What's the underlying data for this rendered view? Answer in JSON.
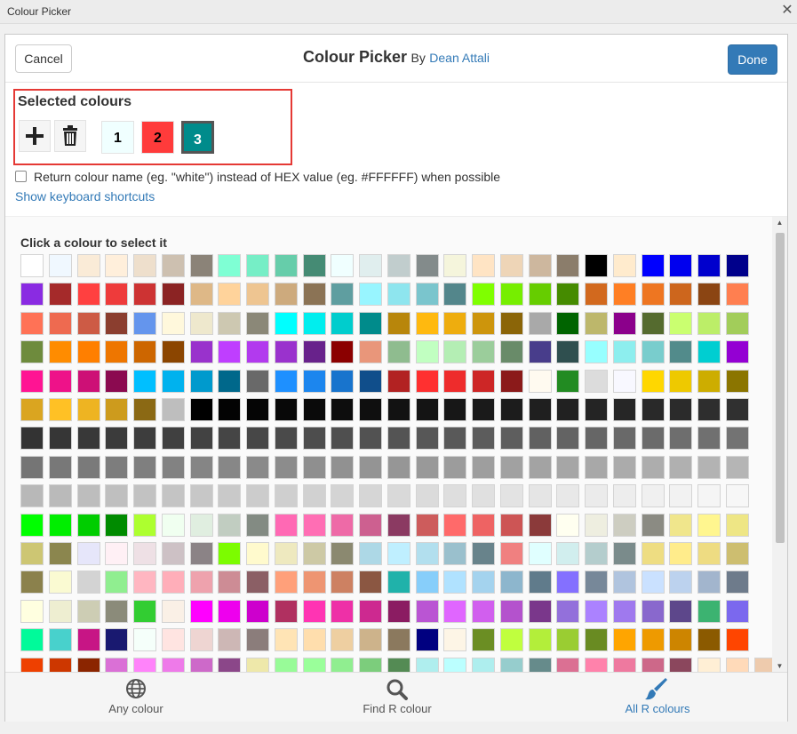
{
  "window": {
    "title": "Colour Picker"
  },
  "header": {
    "cancel_label": "Cancel",
    "title": "Colour Picker",
    "by": "By",
    "author": "Dean Attali",
    "done_label": "Done"
  },
  "selected": {
    "label": "Selected colours",
    "swatches": [
      {
        "label": "1",
        "color": "#F0FFFF",
        "text_color": "#000000"
      },
      {
        "label": "2",
        "color": "#FF3B3B",
        "text_color": "#000000"
      },
      {
        "label": "3",
        "color": "#008B8B",
        "text_color": "#FFFFFF"
      }
    ]
  },
  "options": {
    "return_name_label": "Return colour name (eg. \"white\") instead of HEX value (eg. #FFFFFF) when possible",
    "return_name_checked": false,
    "shortcuts_link": "Show keyboard shortcuts"
  },
  "palette": {
    "label": "Click a colour to select it",
    "rows": [
      [
        "#FFFFFF",
        "#F0F8FF",
        "#FAEBD7",
        "#FFEFDB",
        "#EEDFCC",
        "#CDC0B0",
        "#8B8378",
        "#7FFFD4",
        "#76EEC6",
        "#66CDAA",
        "#458B74",
        "#F0FFFF",
        "#E0EEEE",
        "#C1CDCD",
        "#838B8B",
        "#F5F5DC",
        "#FFE4C4",
        "#EED5B7",
        "#CDB79E",
        "#8B7D6B",
        "#000000",
        "#FFEBCD",
        "#0000FF",
        "#0000EE",
        "#0000CD",
        "#00008B"
      ],
      [
        "#8A2BE2",
        "#A52A2A",
        "#FF4040",
        "#EE3B3B",
        "#CD3333",
        "#8B2323",
        "#DEB887",
        "#FFD39B",
        "#EEC591",
        "#CDAA7D",
        "#8B7355",
        "#5F9EA0",
        "#98F5FF",
        "#8EE5EE",
        "#7AC5CD",
        "#53868B",
        "#7FFF00",
        "#76EE00",
        "#66CD00",
        "#458B00",
        "#D2691E",
        "#FF7F24",
        "#EE7621",
        "#CD661D",
        "#8B4513",
        "#FF7F50"
      ],
      [
        "#FF7256",
        "#EE6A50",
        "#CD5B45",
        "#8B3E2F",
        "#6495ED",
        "#FFF8DC",
        "#EEE8CD",
        "#CDC8B1",
        "#8B8878",
        "#00FFFF",
        "#00EEEE",
        "#00CDCD",
        "#008B8B",
        "#B8860B",
        "#FFB90F",
        "#EEAD0E",
        "#CD950C",
        "#8B6508",
        "#A9A9A9",
        "#006400",
        "#BDB76B",
        "#8B008B",
        "#556B2F",
        "#CAFF70",
        "#BCEE68",
        "#A2CD5A"
      ],
      [
        "#6E8B3D",
        "#FF8C00",
        "#FF7F00",
        "#EE7600",
        "#CD6600",
        "#8B4500",
        "#9932CC",
        "#BF3EFF",
        "#B23AEE",
        "#9A32CD",
        "#68228B",
        "#8B0000",
        "#E9967A",
        "#8FBC8F",
        "#C1FFC1",
        "#B4EEB4",
        "#9BCD9B",
        "#698B69",
        "#483D8B",
        "#2F4F4F",
        "#97FFFF",
        "#8DEEEE",
        "#79CDCD",
        "#528B8B",
        "#00CED1",
        "#9400D3"
      ],
      [
        "#FF1493",
        "#EE1289",
        "#CD1076",
        "#8B0A50",
        "#00BFFF",
        "#00B2EE",
        "#009ACD",
        "#00688B",
        "#696969",
        "#1E90FF",
        "#1C86EE",
        "#1874CD",
        "#104E8B",
        "#B22222",
        "#FF3030",
        "#EE2C2C",
        "#CD2626",
        "#8B1A1A",
        "#FFFAF0",
        "#228B22",
        "#DCDCDC",
        "#F8F8FF",
        "#FFD700",
        "#EEC900",
        "#CDAD00",
        "#8B7500"
      ],
      [
        "#DAA520",
        "#FFC125",
        "#EEB422",
        "#CD9B1D",
        "#8B6914",
        "#BEBEBE",
        "#000000",
        "#030303",
        "#050505",
        "#080808",
        "#0A0A0A",
        "#0D0D0D",
        "#0F0F0F",
        "#121212",
        "#141414",
        "#171717",
        "#1A1A1A",
        "#1C1C1C",
        "#1F1F1F",
        "#212121",
        "#242424",
        "#262626",
        "#292929",
        "#2B2B2B",
        "#2E2E2E",
        "#303030"
      ],
      [
        "#333333",
        "#363636",
        "#383838",
        "#3B3B3B",
        "#3D3D3D",
        "#404040",
        "#424242",
        "#454545",
        "#474747",
        "#4A4A4A",
        "#4D4D4D",
        "#4F4F4F",
        "#525252",
        "#545454",
        "#575757",
        "#595959",
        "#5C5C5C",
        "#5E5E5E",
        "#616161",
        "#636363",
        "#666666",
        "#696969",
        "#6B6B6B",
        "#6E6E6E",
        "#707070",
        "#737373"
      ],
      [
        "#757575",
        "#787878",
        "#7A7A7A",
        "#7D7D7D",
        "#7F7F7F",
        "#828282",
        "#858585",
        "#878787",
        "#8A8A8A",
        "#8C8C8C",
        "#8F8F8F",
        "#919191",
        "#949494",
        "#969696",
        "#999999",
        "#9C9C9C",
        "#9E9E9E",
        "#A1A1A1",
        "#A3A3A3",
        "#A6A6A6",
        "#A8A8A8",
        "#ABABAB",
        "#ADADAD",
        "#B0B0B0",
        "#B3B3B3",
        "#B5B5B5"
      ],
      [
        "#B8B8B8",
        "#BABABA",
        "#BDBDBD",
        "#BFBFBF",
        "#C2C2C2",
        "#C4C4C4",
        "#C7C7C7",
        "#C9C9C9",
        "#CCCCCC",
        "#CFCFCF",
        "#D1D1D1",
        "#D4D4D4",
        "#D6D6D6",
        "#D9D9D9",
        "#DBDBDB",
        "#DEDEDE",
        "#E0E0E0",
        "#E3E3E3",
        "#E5E5E5",
        "#E8E8E8",
        "#EBEBEB",
        "#EDEDED",
        "#F0F0F0",
        "#F2F2F2",
        "#F5F5F5",
        "#F7F7F7"
      ],
      [
        "#00FF00",
        "#00EE00",
        "#00CD00",
        "#008B00",
        "#ADFF2F",
        "#F0FFF0",
        "#E0EEE0",
        "#C1CDC1",
        "#838B83",
        "#FF69B4",
        "#FF6EB4",
        "#EE6AA7",
        "#CD6090",
        "#8B3A62",
        "#CD5C5C",
        "#FF6A6A",
        "#EE6363",
        "#CD5555",
        "#8B3A3A",
        "#FFFFF0",
        "#EEEEE0",
        "#CDCDC1",
        "#8B8B83",
        "#F0E68C",
        "#FFF68F",
        "#EEE685"
      ],
      [
        "#CDC673",
        "#8B864E",
        "#E6E6FA",
        "#FFF0F5",
        "#EEE0E5",
        "#CDC1C5",
        "#8B8386",
        "#7CFC00",
        "#FFFACD",
        "#EEE9BF",
        "#CDC9A5",
        "#8B8970",
        "#ADD8E6",
        "#BFEFFF",
        "#B2DFEE",
        "#9AC0CD",
        "#68838B",
        "#F08080",
        "#E0FFFF",
        "#D1EEEE",
        "#B4CDCD",
        "#7A8B8B",
        "#EEDD82",
        "#FFEC8B",
        "#EEDC82",
        "#CDBE70"
      ],
      [
        "#8B814C",
        "#FAFAD2",
        "#D3D3D3",
        "#90EE90",
        "#FFB6C1",
        "#FFAEB9",
        "#EEA2AD",
        "#CD8C95",
        "#8B5F65",
        "#FFA07A",
        "#EE9572",
        "#CD8162",
        "#8B5742",
        "#20B2AA",
        "#87CEFA",
        "#B0E2FF",
        "#A4D3EE",
        "#8DB6CD",
        "#607B8B",
        "#8470FF",
        "#778899",
        "#B0C4DE",
        "#CAE1FF",
        "#BCD2EE",
        "#A2B5CD",
        "#6E7B8B"
      ],
      [
        "#FFFFE0",
        "#EEEED1",
        "#CDCDB4",
        "#8B8B7A",
        "#32CD32",
        "#FAF0E6",
        "#FF00FF",
        "#EE00EE",
        "#CD00CD",
        "#B03060",
        "#FF34B3",
        "#EE30A7",
        "#CD2990",
        "#8B1C62",
        "#BA55D3",
        "#E066FF",
        "#D15FEE",
        "#B452CD",
        "#7A378B",
        "#9370DB",
        "#AB82FF",
        "#9F79EE",
        "#8968CD",
        "#5D478B",
        "#3CB371",
        "#7B68EE"
      ],
      [
        "#00FA9A",
        "#48D1CC",
        "#C71585",
        "#191970",
        "#F5FFFA",
        "#FFE4E1",
        "#EED5D2",
        "#CDB7B5",
        "#8B7D7B",
        "#FFE4B5",
        "#FFDEAD",
        "#EECFA1",
        "#CDB38B",
        "#8B795E",
        "#000080",
        "#FDF5E6",
        "#6B8E23",
        "#C0FF3E",
        "#B3EE3A",
        "#9ACD32",
        "#698B22",
        "#FFA500",
        "#EE9A00",
        "#CD8500",
        "#8B5A00",
        "#FF4500"
      ],
      [
        "#EE4000",
        "#CD3700",
        "#8B2500",
        "#DA70D6",
        "#FF83FA",
        "#EE7AE9",
        "#CD69C9",
        "#8B4789",
        "#EEE8AA",
        "#98FB98",
        "#9AFF9A",
        "#90EE90",
        "#7CCD7C",
        "#548B54",
        "#AFEEEE",
        "#BBFFFF",
        "#AEEEEE",
        "#96CDCD",
        "#668B8B",
        "#DB7093",
        "#FF82AB",
        "#EE799F",
        "#CD6889",
        "#8B475D",
        "#FFEFD5",
        "#FFDAB9",
        "#EECBAD"
      ]
    ]
  },
  "footer": {
    "tabs": [
      {
        "label": "Any colour",
        "icon": "globe-icon",
        "active": false
      },
      {
        "label": "Find R colour",
        "icon": "search-icon",
        "active": false
      },
      {
        "label": "All R colours",
        "icon": "paintbrush-icon",
        "active": true
      }
    ],
    "active_color": "#337ab7",
    "inactive_color": "#555555"
  }
}
